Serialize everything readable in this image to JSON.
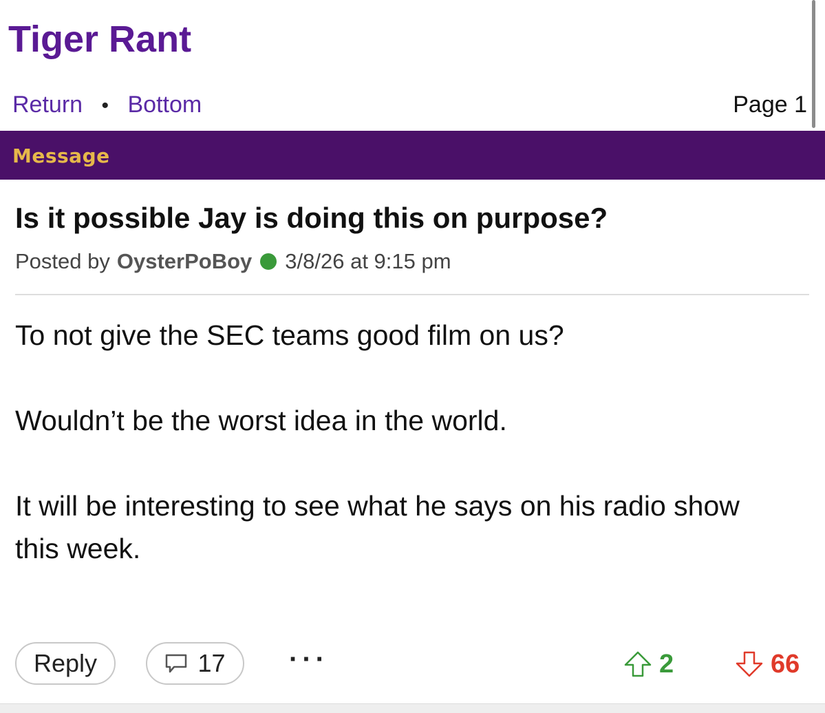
{
  "board": {
    "title": "Tiger Rant"
  },
  "nav": {
    "return_label": "Return",
    "separator": "•",
    "bottom_label": "Bottom",
    "page_label": "Page 1"
  },
  "message_bar": {
    "label": "Message"
  },
  "post": {
    "title": "Is it possible Jay is doing this on purpose?",
    "posted_by_prefix": "Posted by",
    "author": "OysterPoBoy",
    "timestamp": "3/8/26 at 9:15 pm",
    "body": [
      "To not give the SEC teams good film on us?",
      "Wouldn’t be the worst idea in the world.",
      "It will be interesting to see what he says on his radio show this week."
    ]
  },
  "actions": {
    "reply_label": "Reply",
    "comment_count": "17",
    "more_label": "···",
    "upvotes": "2",
    "downvotes": "66"
  },
  "colors": {
    "brand_purple": "#5a1a94",
    "message_bar_bg": "#4a1068",
    "message_bar_text": "#e6b84a",
    "online_green": "#3a9a3a",
    "upvote_green": "#3a9a3a",
    "downvote_red": "#e03a2a"
  },
  "icons": {
    "online_status": "online-status-dot",
    "comments": "speech-bubble-icon",
    "upvote": "arrow-up-icon",
    "downvote": "arrow-down-icon"
  }
}
